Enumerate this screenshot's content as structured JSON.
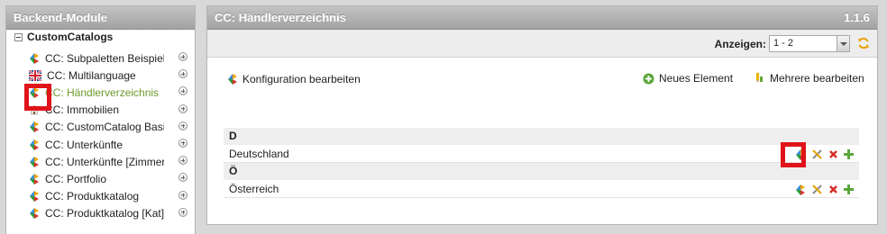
{
  "left": {
    "title": "Backend-Module",
    "root_label": "CustomCatalogs",
    "items": [
      {
        "label": "CC: Subpaletten Beispiel",
        "icon": "catalog-module-icon"
      },
      {
        "label": "CC: Multilanguage",
        "icon": "uk-flag-icon"
      },
      {
        "label": "CC: Händlerverzeichnis",
        "icon": "catalog-module-icon",
        "active": true
      },
      {
        "label": "CC: Immobilien",
        "icon": "house-icon"
      },
      {
        "label": "CC: CustomCatalog Basics",
        "icon": "catalog-module-icon"
      },
      {
        "label": "CC: Unterkünfte",
        "icon": "catalog-module-icon"
      },
      {
        "label": "CC: Unterkünfte [Zimmer]",
        "icon": "catalog-module-icon"
      },
      {
        "label": "CC: Portfolio",
        "icon": "catalog-module-icon"
      },
      {
        "label": "CC: Produktkatalog",
        "icon": "catalog-module-icon"
      },
      {
        "label": "CC: Produktkatalog [Kat]",
        "icon": "catalog-module-icon"
      }
    ]
  },
  "main": {
    "title": "CC: Händlerverzeichnis",
    "version": "1.1.6",
    "show_label": "Anzeigen:",
    "show_value": "1 - 2",
    "config_link": "Konfiguration bearbeiten",
    "new_element": "Neues Element",
    "edit_multiple": "Mehrere bearbeiten",
    "groups": [
      {
        "letter": "D",
        "rows": [
          "Deutschland"
        ]
      },
      {
        "letter": "Ö",
        "rows": [
          "Österreich"
        ]
      }
    ]
  },
  "colors": {
    "highlight": "#e0131a",
    "active_text": "#6b9a2b",
    "header_gray": "#a2a2a2"
  }
}
